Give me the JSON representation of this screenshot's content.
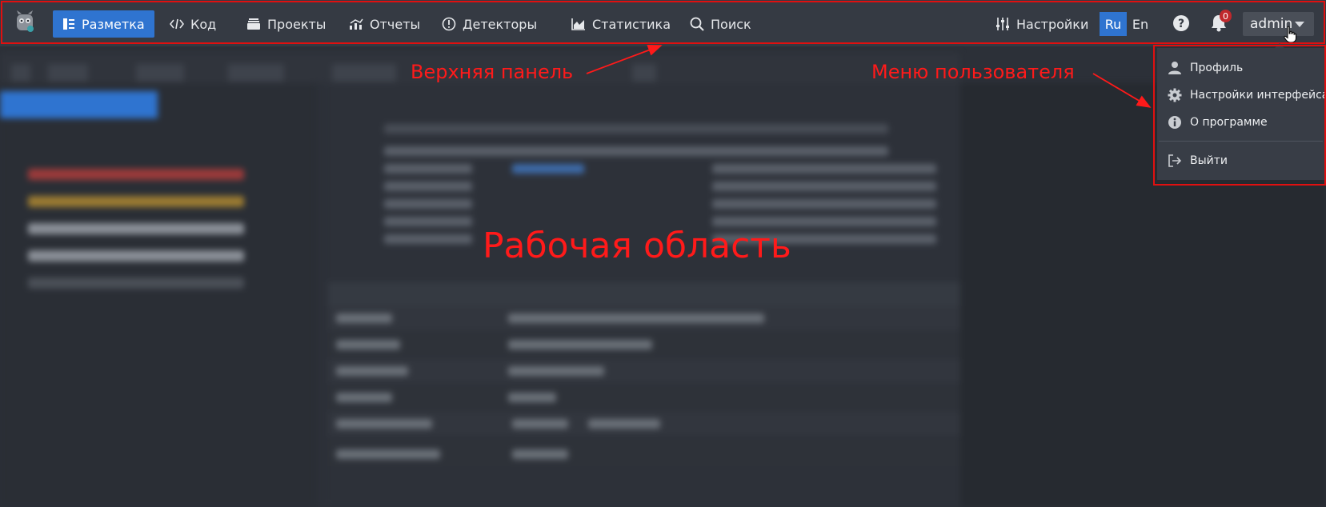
{
  "topbar": {
    "nav": [
      {
        "label": "Разметка",
        "icon": "markup-icon",
        "active": true
      },
      {
        "label": "Код",
        "icon": "code-icon"
      },
      {
        "label": "Проекты",
        "icon": "projects-icon"
      },
      {
        "label": "Отчеты",
        "icon": "reports-icon"
      },
      {
        "label": "Детекторы",
        "icon": "detectors-icon"
      },
      {
        "label": "Статистика",
        "icon": "statistics-icon"
      },
      {
        "label": "Поиск",
        "icon": "search-icon"
      }
    ],
    "settings_label": "Настройки",
    "lang": {
      "ru": "Ru",
      "en": "En",
      "active": "Ru"
    },
    "notifications_count": "0",
    "user": "admin"
  },
  "user_menu": {
    "items": [
      {
        "label": "Профиль",
        "icon": "user-icon"
      },
      {
        "label": "Настройки интерфейса",
        "icon": "gear-icon"
      },
      {
        "label": "О программе",
        "icon": "info-icon"
      },
      {
        "label": "Выйти",
        "icon": "logout-icon"
      }
    ]
  },
  "annotations": {
    "topbar": "Верхняя панель",
    "user_menu": "Меню пользователя",
    "workspace": "Рабочая область"
  },
  "colors": {
    "accent": "#2f74d0",
    "annotation": "#ff1a1a",
    "topbar_bg": "#353a43",
    "badge": "#c0282c"
  }
}
